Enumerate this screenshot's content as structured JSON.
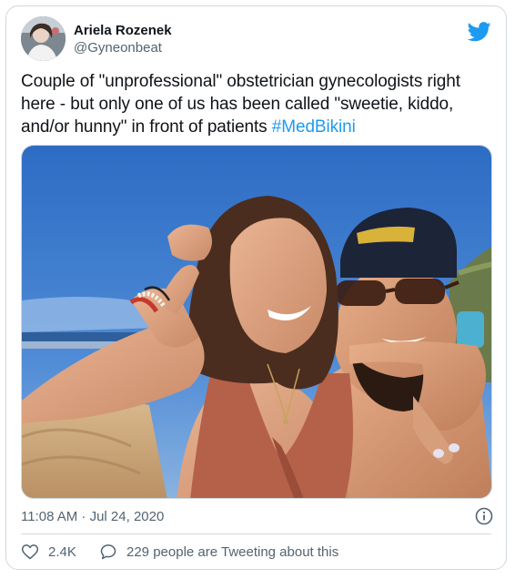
{
  "author": {
    "name": "Ariela Rozenek",
    "handle": "@Gyneonbeat",
    "avatar_icon": "avatar-photo"
  },
  "brand": {
    "icon": "twitter-bird-icon",
    "color": "#1d9bf0"
  },
  "tweet": {
    "text": "Couple of \"unprofessional\" obstetrician gynecologists right here - but only one of us has been called \"sweetie, kiddo, and/or hunny\" in front of patients",
    "hashtag": "#MedBikini"
  },
  "timestamp": "11:08 AM · Jul 24, 2020",
  "stats": {
    "likes": "2.4K",
    "tweeting": "229 people are Tweeting about this"
  },
  "colors": {
    "text": "#0f1419",
    "muted": "#536471",
    "link": "#1d9bf0",
    "border": "#cfd9de"
  }
}
